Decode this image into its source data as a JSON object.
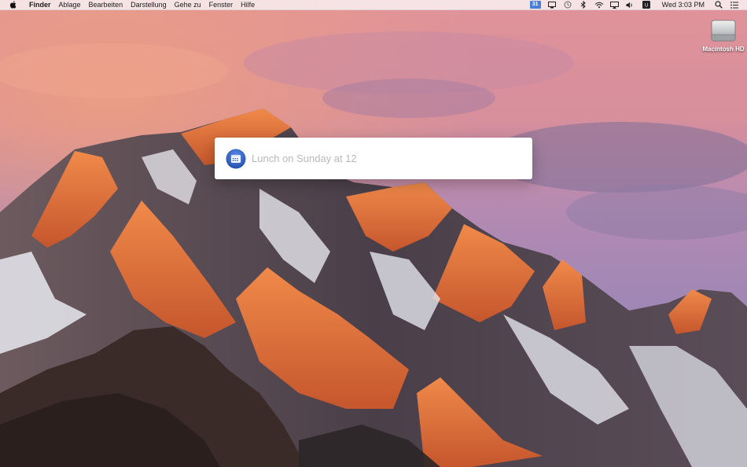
{
  "menubar": {
    "apple_icon": "apple-logo-icon",
    "app_name": "Finder",
    "items": [
      "Ablage",
      "Bearbeiten",
      "Darstellung",
      "Gehe zu",
      "Fenster",
      "Hilfe"
    ],
    "status": {
      "calendar_badge": "31",
      "clock": "Wed 3:03 PM",
      "icons": [
        "calendar-icon",
        "display-icon",
        "time-machine-icon",
        "bluetooth-icon",
        "wifi-icon",
        "airplay-icon",
        "volume-icon",
        "input-source-icon",
        "spotlight-icon",
        "notification-center-icon"
      ]
    }
  },
  "desktop": {
    "drive_label": "Macintosh HD"
  },
  "quick_entry": {
    "placeholder": "Lunch on Sunday at 12",
    "value": ""
  },
  "colors": {
    "accent": "#2f6fd6",
    "panel": "#ffffff",
    "placeholder": "#b9b9b9"
  }
}
